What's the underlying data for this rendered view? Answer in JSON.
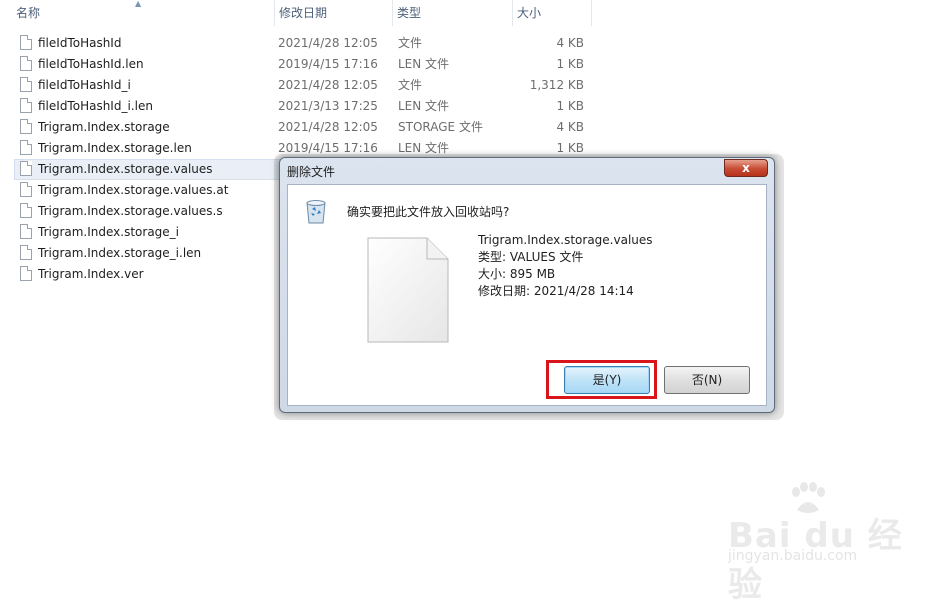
{
  "columns": {
    "name": "名称",
    "date": "修改日期",
    "type": "类型",
    "size": "大小"
  },
  "files": [
    {
      "name": "fileIdToHashId",
      "date": "2021/4/28 12:05",
      "type": "文件",
      "size": "4 KB"
    },
    {
      "name": "fileIdToHashId.len",
      "date": "2019/4/15 17:16",
      "type": "LEN 文件",
      "size": "1 KB"
    },
    {
      "name": "fileIdToHashId_i",
      "date": "2021/4/28 12:05",
      "type": "文件",
      "size": "1,312 KB"
    },
    {
      "name": "fileIdToHashId_i.len",
      "date": "2021/3/13 17:25",
      "type": "LEN 文件",
      "size": "1 KB"
    },
    {
      "name": "Trigram.Index.storage",
      "date": "2021/4/28 12:05",
      "type": "STORAGE 文件",
      "size": "4 KB"
    },
    {
      "name": "Trigram.Index.storage.len",
      "date": "2019/4/15 17:16",
      "type": "LEN 文件",
      "size": "1 KB"
    },
    {
      "name": "Trigram.Index.storage.values",
      "date": "",
      "type": "",
      "size": "",
      "selected": true
    },
    {
      "name": "Trigram.Index.storage.values.at",
      "date": "",
      "type": "",
      "size": ""
    },
    {
      "name": "Trigram.Index.storage.values.s",
      "date": "",
      "type": "",
      "size": ""
    },
    {
      "name": "Trigram.Index.storage_i",
      "date": "",
      "type": "",
      "size": ""
    },
    {
      "name": "Trigram.Index.storage_i.len",
      "date": "",
      "type": "",
      "size": ""
    },
    {
      "name": "Trigram.Index.ver",
      "date": "",
      "type": "",
      "size": ""
    }
  ],
  "dialog": {
    "title": "删除文件",
    "close_label": "x",
    "question": "确实要把此文件放入回收站吗?",
    "file_name": "Trigram.Index.storage.values",
    "file_type": "类型: VALUES 文件",
    "file_size": "大小: 895 MB",
    "file_date": "修改日期: 2021/4/28 14:14",
    "yes_label": "是(Y)",
    "no_label": "否(N)"
  },
  "watermark": {
    "brand": "Bai du 经验",
    "url": "jingyan.baidu.com"
  },
  "icons": {
    "file": "file-icon",
    "recycle_bin": "recycle-bin-icon",
    "large_file": "large-file-icon"
  },
  "colors": {
    "highlight_box": "#d9141b",
    "close_button": "#c74b33",
    "selection": "#e9eef7"
  }
}
